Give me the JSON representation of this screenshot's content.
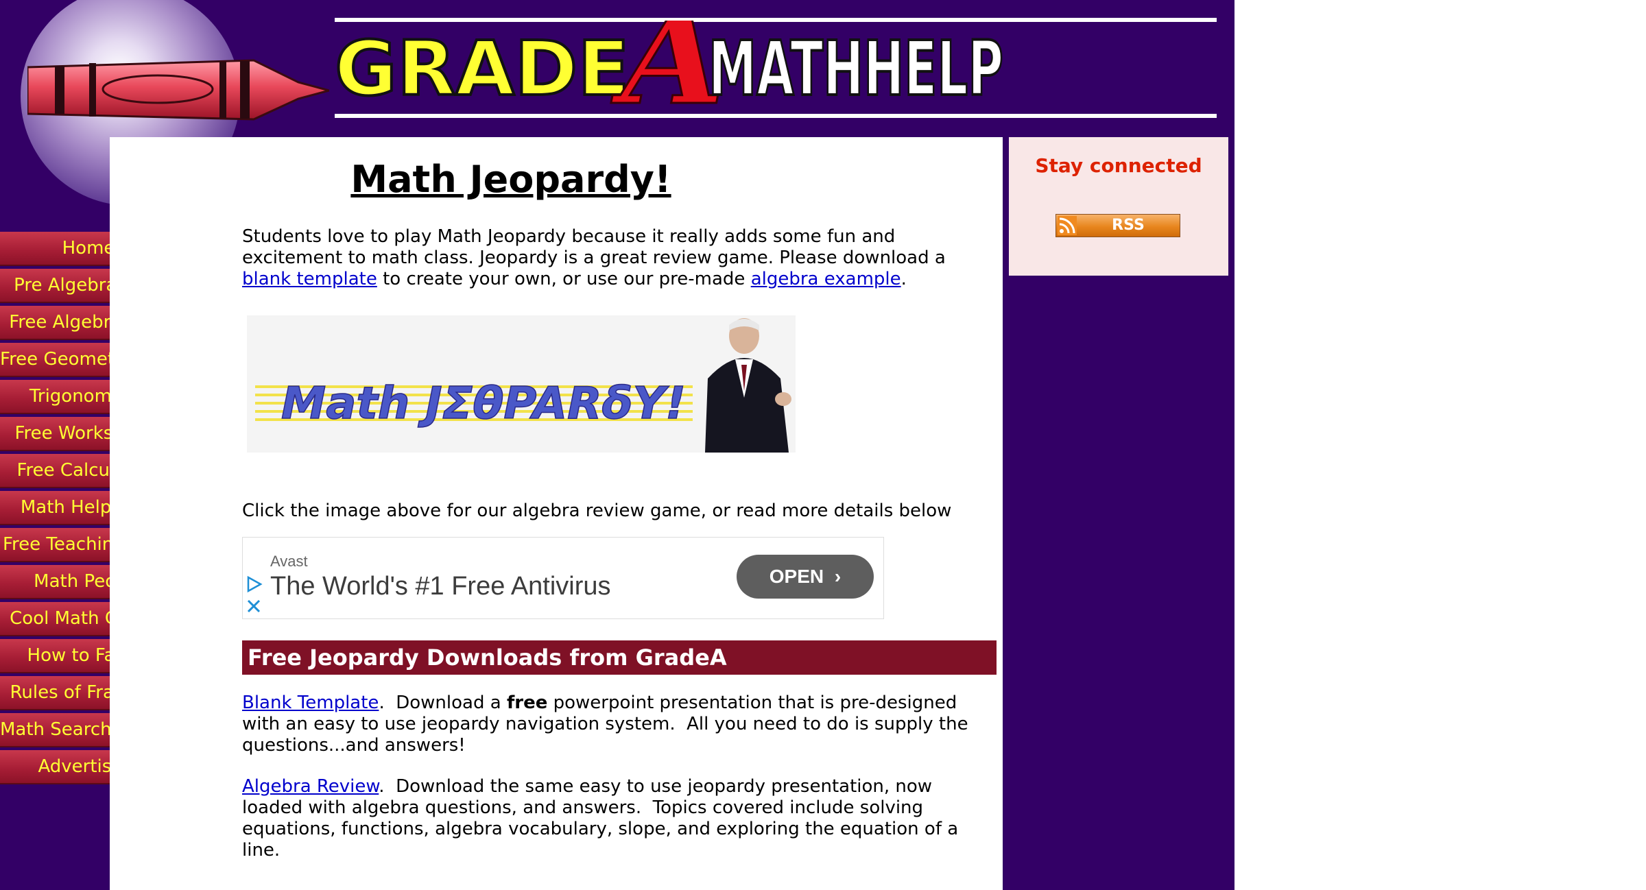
{
  "header": {
    "logo_text": "GRADEAMATHHELP",
    "logo_part1": "GRADE",
    "logo_part2": "A",
    "logo_part3": "MATHHELP"
  },
  "nav": {
    "items": [
      {
        "label": "Home"
      },
      {
        "label": "Pre Algebra Help"
      },
      {
        "label": "Free Algebra Help"
      },
      {
        "label": "Free Geometry Help"
      },
      {
        "label": "Trigonometry"
      },
      {
        "label": "Free Worksheets"
      },
      {
        "label": "Free Calculators"
      },
      {
        "label": "Math Help Blog"
      },
      {
        "label": "Free Teaching Tools"
      },
      {
        "label": "Math People"
      },
      {
        "label": "Cool Math Games"
      },
      {
        "label": "How to Factor"
      },
      {
        "label": "Rules of Fractions"
      },
      {
        "label": "Math Search Engine"
      },
      {
        "label": "Advertising"
      }
    ]
  },
  "main": {
    "title": "Math Jeopardy!",
    "intro": {
      "text1": "Students love to play Math Jeopardy because it really adds some fun and excitement to math class. Jeopardy is a great review game. Please download a ",
      "link1": "blank template",
      "text2": " to create your own, or use our pre-made ",
      "link2": "algebra example",
      "text3": "."
    },
    "banner": {
      "text": "Math JΣθPARδY!"
    },
    "click_text": "Click the image above for our algebra review game, or read more details below",
    "ad": {
      "advertiser": "Avast",
      "headline": "The World's #1 Free Antivirus",
      "button": "OPEN"
    },
    "section_title": "Free Jeopardy Downloads from GradeA",
    "blank_template": {
      "link": "Blank Template",
      "text1": ".  Download a ",
      "bold": "free",
      "text2": " powerpoint presentation that is pre-designed with an easy to use jeopardy navigation system.  All you need to do is supply the questions...and answers!"
    },
    "algebra_review": {
      "link": "Algebra Review",
      "text": ".  Download the same easy to use jeopardy presentation, now loaded with algebra questions, and answers.  Topics covered include solving equations, functions, algebra vocabulary, slope, and exploring the equation of a line."
    }
  },
  "sidebar_right": {
    "heading": "Stay connected",
    "rss_label": "RSS"
  },
  "colors": {
    "site_background": "#330066",
    "nav_button": "#a81e36",
    "nav_text": "#ffff33",
    "section_bar": "#7f1126",
    "link": "#0000cc",
    "accent_red": "#dd2200",
    "logo_yellow": "#ffff33"
  }
}
